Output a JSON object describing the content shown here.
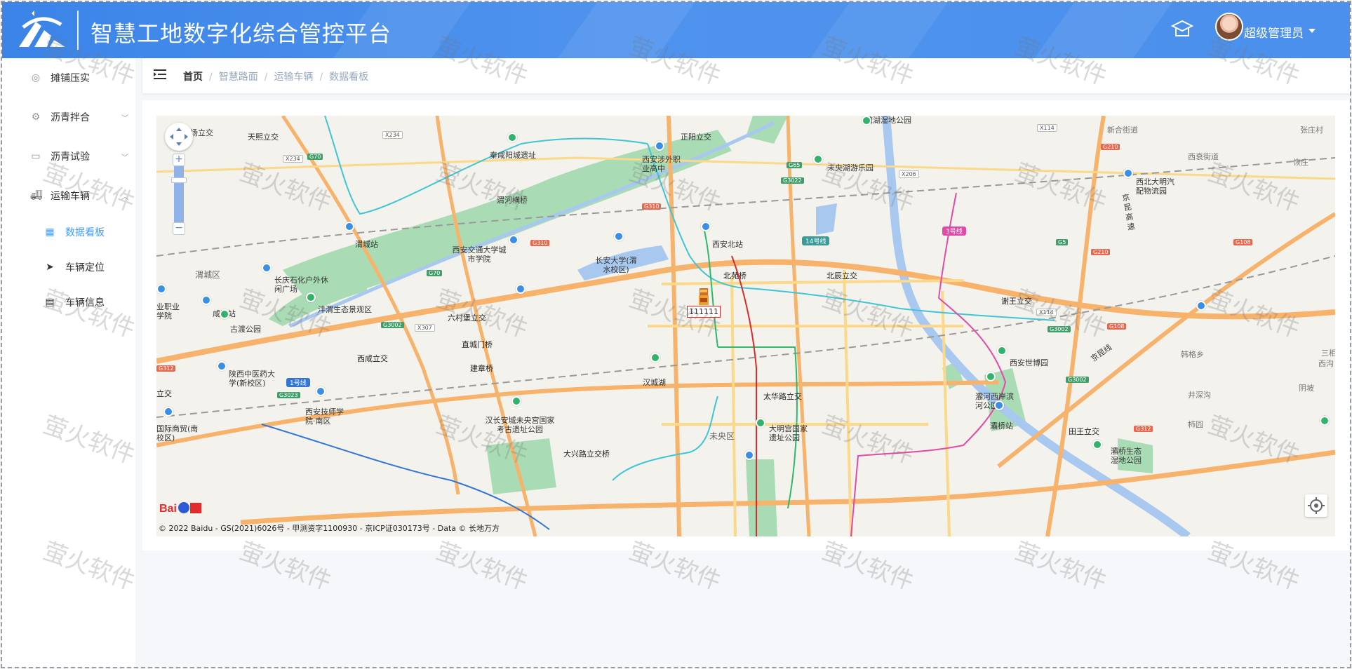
{
  "header": {
    "title": "智慧工地数字化综合管控平台",
    "user_name": "超级管理员",
    "home_icon": "graduation-cap-icon",
    "bg_color": "#4a90ec"
  },
  "sidebar": {
    "items": [
      {
        "label": "摊铺压实",
        "icon": "check-circle-icon"
      },
      {
        "label": "沥青拌合",
        "icon": "gear-icon"
      },
      {
        "label": "沥青试验",
        "icon": "toolbox-icon"
      },
      {
        "label": "运输车辆",
        "icon": "truck-icon"
      },
      {
        "label": "数据看板",
        "icon": "dashboard-icon",
        "active": true
      },
      {
        "label": "车辆定位",
        "icon": "send-icon"
      },
      {
        "label": "车辆信息",
        "icon": "document-icon"
      }
    ],
    "active_color": "#409eff"
  },
  "breadcrumb": {
    "items": [
      "首页",
      "智慧路面",
      "运输车辆",
      "数据看板"
    ],
    "separator": "/"
  },
  "map": {
    "labels": {
      "l1": "场立交",
      "l2": "天熙立交",
      "l3": "秦咸阳城遗址",
      "l4": "正阳立交",
      "l5": "西安涉外职业高中",
      "l6": "未央湖游乐园",
      "l7": "渭河横桥",
      "l8": "渭城站",
      "l9": "西安交通大学城市学院",
      "l10": "长安大学(渭水校区)",
      "l11": "西安北站",
      "l12": "北苑桥",
      "l13": "北辰立交",
      "l14": "渭城区",
      "l15": "长庆石化户外休闲广场",
      "l16": "咸阳站",
      "l17": "古渡公园",
      "l18": "沣渭生态景观区",
      "l19": "六村堡立交",
      "l20": "直城门桥",
      "l21": "西咸立交",
      "l22": "建章桥",
      "l23": "汉城湖",
      "l24": "太华路立交",
      "l25": "谢王立交",
      "l26": "西安世博园",
      "l27": "灞河西岸滨河公园",
      "l28": "灞桥站",
      "l29": "陕西中医药大学(新校区)",
      "l30": "西安技师学院·南区",
      "l31": "汉长安城未央宫国家考古遗址公园",
      "l32": "未央区",
      "l33": "大明宫国家遗址公园",
      "l34": "大兴路立交桥",
      "l35": "田王立交",
      "l36": "灞桥生态湿地公园",
      "l37": "西北大明汽配物流园",
      "l38": "新合街道",
      "l39": "西衰街道",
      "l40": "张庄村",
      "l41": "恢庄",
      "l42": "京昆高速",
      "l43": "京昆线",
      "l44": "韩格乡",
      "l45": "井深沟",
      "l46": "柿园",
      "l47": "阴坡",
      "l48": "三相",
      "l49": "西沟",
      "l50": "业职业学院",
      "l51": "国际商贸(南校区)",
      "l52": "立交",
      "l53": "漕湖湿地公园"
    },
    "metro": {
      "m1": "14号线",
      "m2": "3号线",
      "m3": "1号线"
    },
    "shields": {
      "s1": "X234",
      "s2": "G70",
      "s3": "X234",
      "s4": "G310",
      "s5": "G310",
      "s6": "G70",
      "s7": "G65",
      "s8": "G3022",
      "s9": "X206",
      "s10": "X114",
      "s11": "G210",
      "s12": "G5",
      "s13": "G210",
      "s14": "G108",
      "s15": "X114",
      "s16": "G3002",
      "s17": "G108",
      "s18": "G3002",
      "s19": "X307",
      "s20": "G312",
      "s21": "G3023",
      "s22": "G3002",
      "s23": "G312"
    },
    "vehicle": {
      "plate": "111111",
      "icon": "truck-marker-icon"
    },
    "copyright": "© 2022 Baidu - GS(2021)6026号 - 甲测资字1100930 - 京ICP证030173号 - Data © 长地万方",
    "logo_text": "Bai地图"
  },
  "watermark": "萤火软件"
}
